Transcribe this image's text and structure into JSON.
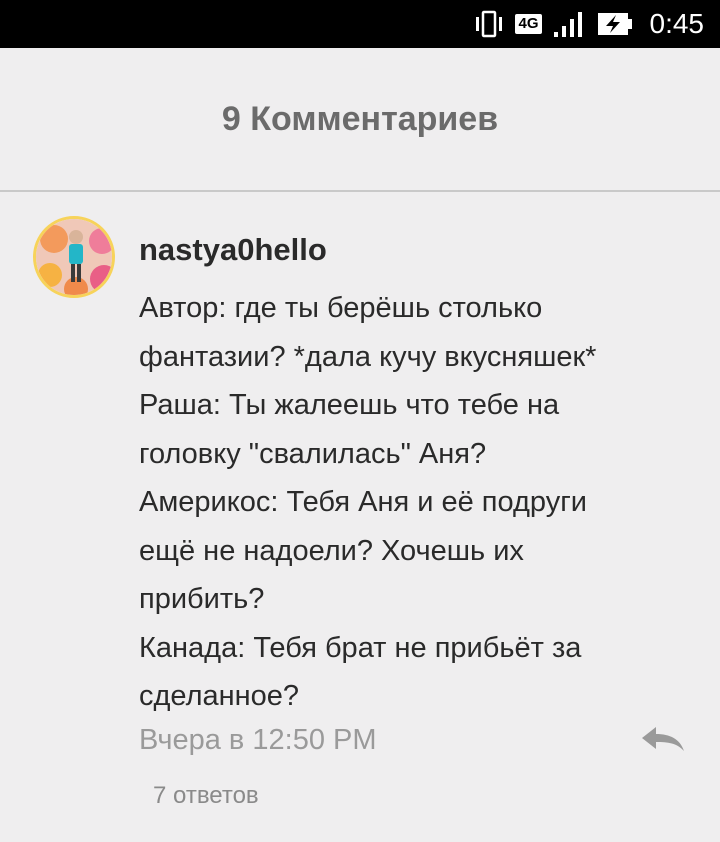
{
  "status_bar": {
    "network": "4G",
    "time": "0:45"
  },
  "header": {
    "title": "9 Комментариев"
  },
  "comment": {
    "username": "nastya0hello",
    "lines": [
      "Автор: где ты берёшь столько",
      "фантазии? *дала кучу вкусняшек*",
      "Раша: Ты жалеешь что тебе на",
      "головку \"свалилась\" Аня?",
      "Америкос: Тебя Аня и её подруги",
      "ещё не надоели? Хочешь их",
      "прибить?",
      "Канада: Тебя брат не прибьёт за",
      "сделанное?"
    ],
    "timestamp": "Вчера в 12:50 PM",
    "replies_label": "7 ответов"
  },
  "colors": {
    "background": "#efeeef",
    "status_bar": "#000000",
    "text": "#2a2a2a",
    "muted": "#9a9a9a"
  },
  "icons": [
    "vibrate-icon",
    "signal-icon",
    "battery-charging-icon",
    "reply-icon"
  ]
}
